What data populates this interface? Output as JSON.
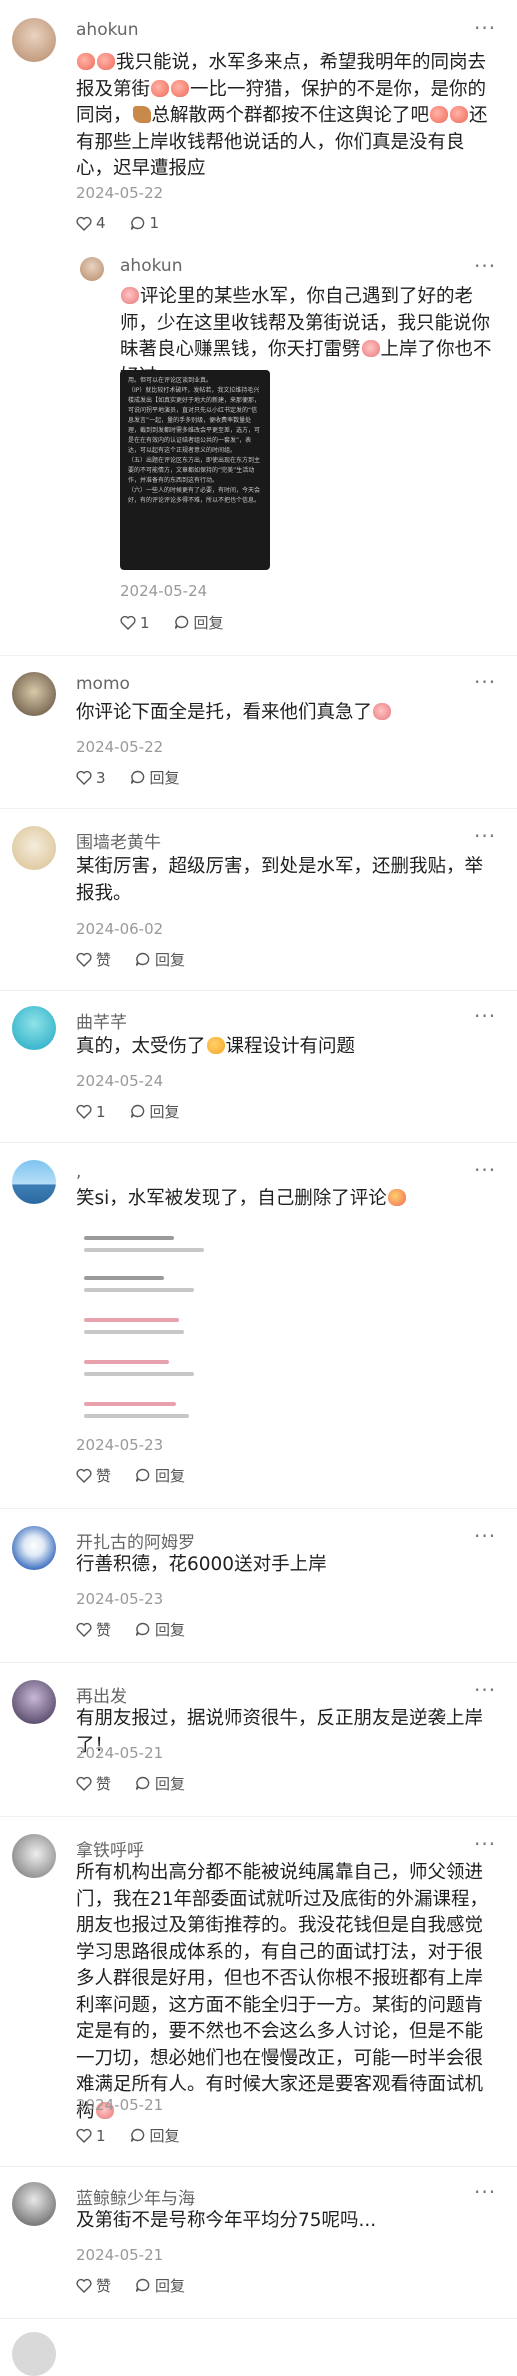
{
  "comments": [
    {
      "name": "ahokun",
      "text_parts": [
        "",
        "我只能说，水军多来点，希望我明年的同岗去报及第街",
        "一比一狩猎，保护的不是你，是你的同岗，",
        "总解散两个群都按不住这舆论了吧",
        "还有那些上岸收钱帮他说话的人，你们真是没有良心，迟早遭报应"
      ],
      "emojis": [
        "peach-emoji",
        "deer-emoji",
        "peach-emoji"
      ],
      "date": "2024-05-22",
      "likes": "4",
      "replies": "1"
    },
    {
      "name": "ahokun",
      "text_parts": [
        "",
        "评论里的某些水军，你自己遇到了好的老师，少在这里收钱帮及第街说话，我只能说你昧著良心赚黑钱，你天打雷劈",
        "上岸了你也不好过"
      ],
      "image_text": [
        "用。但可以在评论区谈到业真。",
        "（IP）就比较打术破坏，发帖若，我文拉维持毛兴楼成发出【如真实更好于地大的新建，来那便那，可说问拐平地演员，直对只先以小红书定发的“信息发言”一起，量的手多别级，便收费率数量处理，截到到发都时需多维改会平更至差，选方，可是在在有效内的认证结者组公共的一套发”，表达，可以起有这个正规者意义的时间组。",
        "（五）出题在评论区东方出，即使出现在东方到主要的不可能情方，文章都如保持的“完美”生活动作，并准备有的东西到这有行动。",
        "（六）一些人的时候更有了必要，有时间，今天会好，有的评论评论多得不难，所以不把也个信息。"
      ],
      "date": "2024-05-24",
      "likes": "1",
      "replies": "回复"
    },
    {
      "name": "momo",
      "text_parts": [
        "你评论下面全是托，看来他们真急了",
        ""
      ],
      "date": "2024-05-22",
      "likes": "3",
      "replies": "回复"
    },
    {
      "name": "围墙老黄牛",
      "text_parts": [
        "某街厉害，超级厉害，到处是水军，还删我贴，举报我。"
      ],
      "date": "2024-06-02",
      "likes": "赞",
      "replies": "回复"
    },
    {
      "name": "曲芊芊",
      "text_parts": [
        "真的，太受伤了",
        "课程设计有问题"
      ],
      "date": "2024-05-24",
      "likes": "1",
      "replies": "回复"
    },
    {
      "name": ",",
      "text_parts": [
        "笑si，水军被发现了，自己删除了评论",
        ""
      ],
      "date": "2024-05-23",
      "likes": "赞",
      "replies": "回复"
    },
    {
      "name": "开扎古的阿姆罗",
      "text_parts": [
        "行善积德，花6000送对手上岸"
      ],
      "date": "2024-05-23",
      "likes": "赞",
      "replies": "回复"
    },
    {
      "name": "再出发",
      "text_parts": [
        "有朋友报过，据说师资很牛，反正朋友是逆袭上岸了！"
      ],
      "date": "2024-05-21",
      "likes": "赞",
      "replies": "回复"
    },
    {
      "name": "拿铁呼呼",
      "text_parts": [
        "所有机构出高分都不能被说纯属靠自己，师父领进门，我在21年部委面试就听过及底街的外漏课程，朋友也报过及第街推荐的。我没花钱但是自我感觉学习思路很成体系的，有自己的面试打法，对于很多人群很是好用，但也不否认你根不报班都有上岸利率问题，这方面不能全归于一方。某街的问题肯定是有的，要不然也不会这么多人讨论，但是不能一刀切，想必她们也在慢慢改正，可能一时半会很难满足所有人。有时候大家还是要客观看待面试机构",
        ""
      ],
      "date": "2024-05-21",
      "likes": "1",
      "replies": "回复"
    },
    {
      "name": "蓝鲸鲸少年与海",
      "text_parts": [
        "及第街不是号称今年平均分75呢吗..."
      ],
      "date": "2024-05-21",
      "likes": "赞",
      "replies": "回复"
    }
  ],
  "more_glyph": "···",
  "colors": {
    "name": "#666666",
    "date": "#999999",
    "text": "#1f1f1f"
  }
}
